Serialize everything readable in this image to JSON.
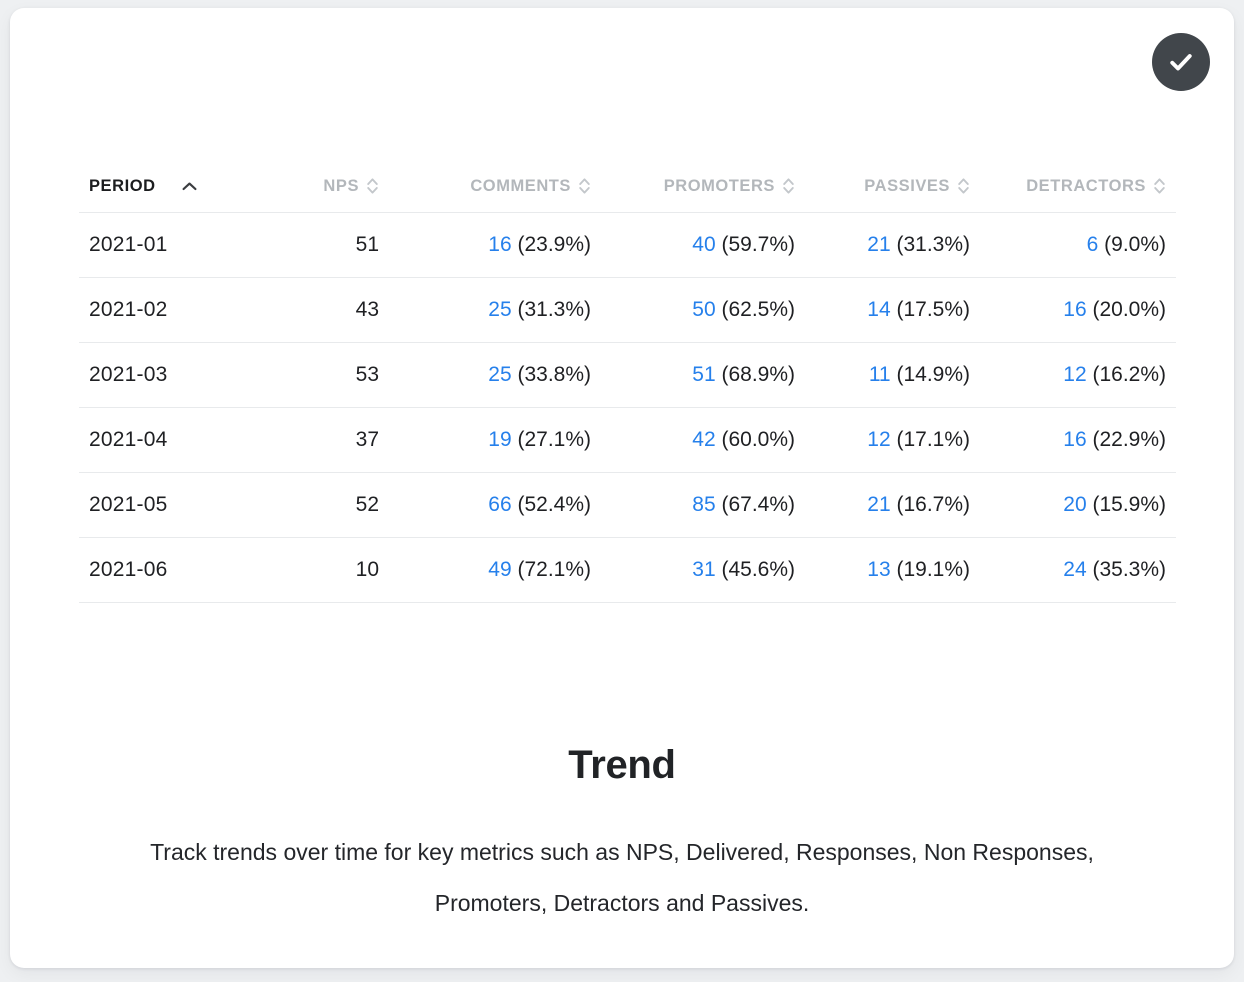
{
  "card": {
    "status_badge": {
      "icon": "check-circle-icon",
      "background_color": "#41464b",
      "mark_color": "#ffffff"
    }
  },
  "table": {
    "sort": {
      "active_column": "PERIOD",
      "direction": "asc",
      "active_icon": "chevron-up-icon",
      "inactive_icon": "chevron-up-down-icon"
    },
    "columns": [
      {
        "label": "PERIOD",
        "align": "left",
        "active": true
      },
      {
        "label": "NPS",
        "align": "right",
        "active": false
      },
      {
        "label": "COMMENTS",
        "align": "right",
        "active": false
      },
      {
        "label": "PROMOTERS",
        "align": "right",
        "active": false
      },
      {
        "label": "PASSIVES",
        "align": "right",
        "active": false
      },
      {
        "label": "DETRACTORS",
        "align": "right",
        "active": false
      }
    ],
    "link_color": "#2680eb",
    "rows": [
      {
        "period": "2021-01",
        "nps": "51",
        "comments": {
          "count": "16",
          "percent": "(23.9%)"
        },
        "promoters": {
          "count": "40",
          "percent": "(59.7%)"
        },
        "passives": {
          "count": "21",
          "percent": "(31.3%)"
        },
        "detractors": {
          "count": "6",
          "percent": "(9.0%)"
        }
      },
      {
        "period": "2021-02",
        "nps": "43",
        "comments": {
          "count": "25",
          "percent": "(31.3%)"
        },
        "promoters": {
          "count": "50",
          "percent": "(62.5%)"
        },
        "passives": {
          "count": "14",
          "percent": "(17.5%)"
        },
        "detractors": {
          "count": "16",
          "percent": "(20.0%)"
        }
      },
      {
        "period": "2021-03",
        "nps": "53",
        "comments": {
          "count": "25",
          "percent": "(33.8%)"
        },
        "promoters": {
          "count": "51",
          "percent": "(68.9%)"
        },
        "passives": {
          "count": "11",
          "percent": "(14.9%)"
        },
        "detractors": {
          "count": "12",
          "percent": "(16.2%)"
        }
      },
      {
        "period": "2021-04",
        "nps": "37",
        "comments": {
          "count": "19",
          "percent": "(27.1%)"
        },
        "promoters": {
          "count": "42",
          "percent": "(60.0%)"
        },
        "passives": {
          "count": "12",
          "percent": "(17.1%)"
        },
        "detractors": {
          "count": "16",
          "percent": "(22.9%)"
        }
      },
      {
        "period": "2021-05",
        "nps": "52",
        "comments": {
          "count": "66",
          "percent": "(52.4%)"
        },
        "promoters": {
          "count": "85",
          "percent": "(67.4%)"
        },
        "passives": {
          "count": "21",
          "percent": "(16.7%)"
        },
        "detractors": {
          "count": "20",
          "percent": "(15.9%)"
        }
      },
      {
        "period": "2021-06",
        "nps": "10",
        "comments": {
          "count": "49",
          "percent": "(72.1%)"
        },
        "promoters": {
          "count": "31",
          "percent": "(45.6%)"
        },
        "passives": {
          "count": "13",
          "percent": "(19.1%)"
        },
        "detractors": {
          "count": "24",
          "percent": "(35.3%)"
        }
      }
    ]
  },
  "footer": {
    "title": "Trend",
    "description": "Track trends over time for key metrics such as NPS, Delivered, Responses, Non Responses, Promoters, Detractors and Passives."
  }
}
